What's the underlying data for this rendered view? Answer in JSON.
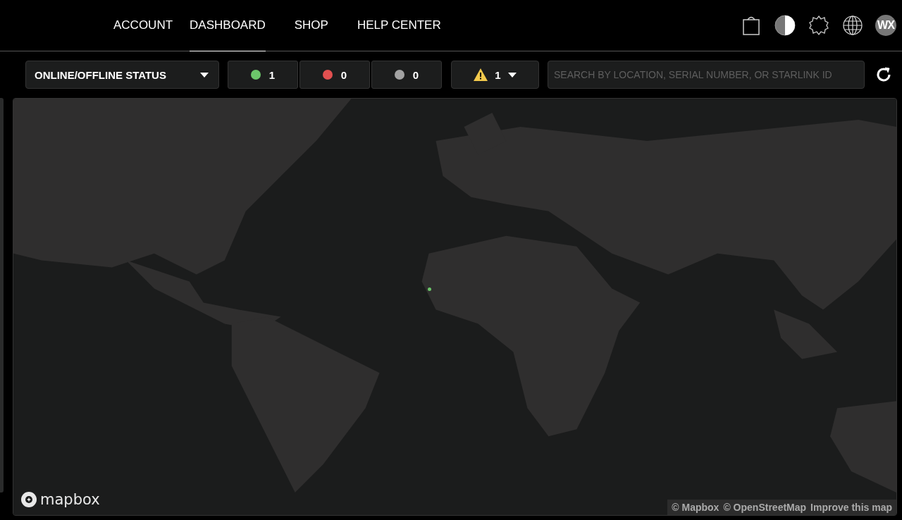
{
  "nav": {
    "items": [
      {
        "label": "ACCOUNT",
        "selected": false
      },
      {
        "label": "DASHBOARD",
        "selected": true
      },
      {
        "label": "SHOP",
        "selected": false
      },
      {
        "label": "HELP CENTER",
        "selected": false
      }
    ],
    "avatar": "WX"
  },
  "toolbar": {
    "status_filter": "ONLINE/OFFLINE STATUS",
    "status_counts": [
      {
        "count": "1",
        "color": "#6cc66a"
      },
      {
        "count": "0",
        "color": "#e25050"
      },
      {
        "count": "0",
        "color": "#a3a3a3"
      }
    ],
    "alerts": {
      "count": "1"
    },
    "search": {
      "placeholder": "SEARCH BY LOCATION, SERIAL NUMBER, OR STARLINK ID"
    }
  },
  "map": {
    "kind": "picture",
    "markers": [
      {
        "color": "#6cc66a"
      }
    ],
    "logo": "mapbox",
    "attribution": [
      {
        "label": "© Mapbox"
      },
      {
        "label": "© OpenStreetMap"
      },
      {
        "label": "Improve this map"
      }
    ]
  }
}
